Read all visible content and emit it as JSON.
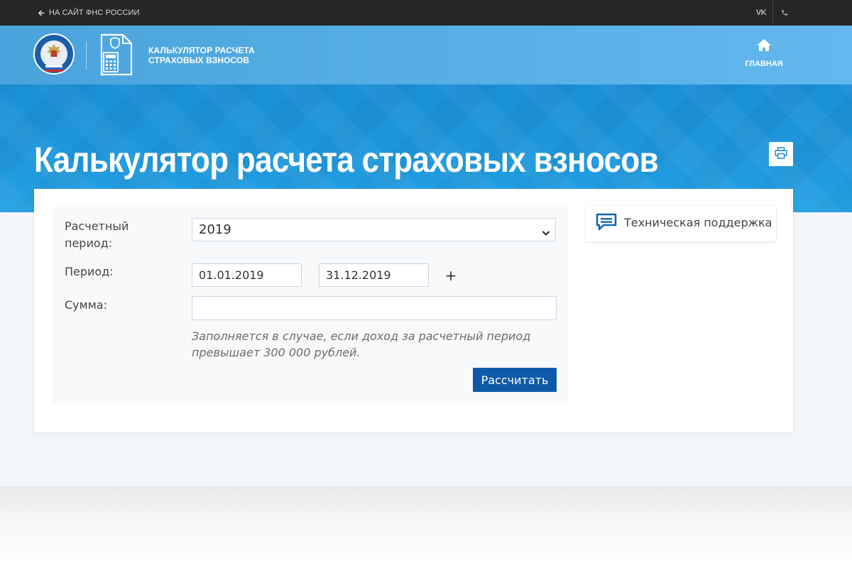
{
  "topbar": {
    "back_link": "НА САЙТ ФНС РОССИИ",
    "vk_label": "VK",
    "icons": [
      "arrow-left-icon",
      "vk-icon",
      "phone-icon"
    ]
  },
  "header": {
    "emblem_text": "ФЕДЕРАЛЬНАЯ НАЛОГОВАЯ СЛУЖБА",
    "app_title_line1": "КАЛЬКУЛЯТОР РАСЧЕТА",
    "app_title_line2": "СТРАХОВЫХ ВЗНОСОВ",
    "nav_home": "ГЛАВНАЯ"
  },
  "banner": {
    "title": "Калькулятор расчета страховых взносов"
  },
  "form": {
    "period_type_label": "Расчетный период:",
    "period_type_value": "2019",
    "period_label": "Период:",
    "date_from": "01.01.2019",
    "date_to": "31.12.2019",
    "add_period": "+",
    "sum_label": "Сумма:",
    "sum_value": "",
    "hint": "Заполняется в случае, если доход за расчетный период превышает 300 000 рублей.",
    "submit": "Рассчитать"
  },
  "sidebar": {
    "support": "Техническая поддержка"
  },
  "colors": {
    "topbar": "#262626",
    "header": "#56aee5",
    "banner": "#1f98dd",
    "page_bg": "#f2f5fa",
    "primary_button": "#0f5aa8",
    "support_icon": "#1565b5"
  }
}
